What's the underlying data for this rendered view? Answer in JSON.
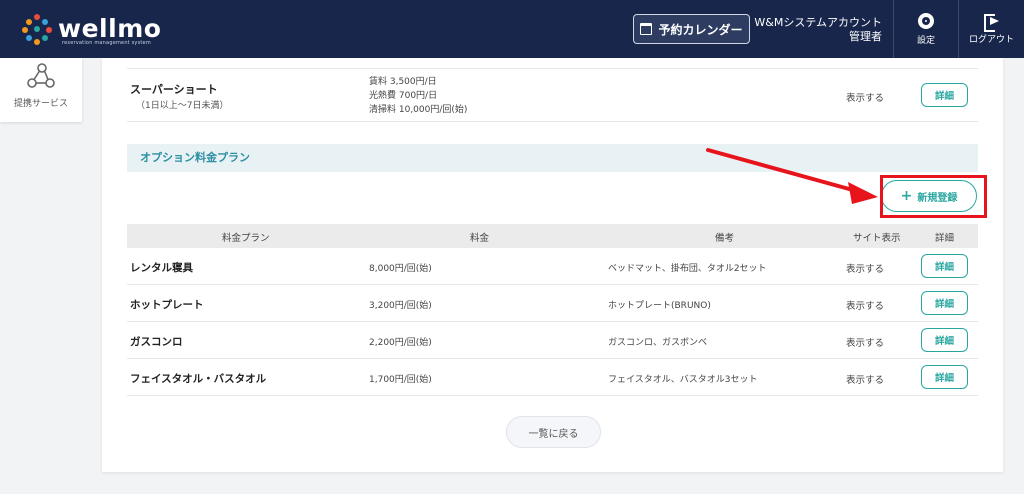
{
  "header": {
    "logo_text": "wellmo",
    "logo_tagline": "reservation management system",
    "calendar_button": "予約カレンダー",
    "account_name": "W&Mシステムアカウント",
    "account_role": "管理者",
    "settings_label": "設定",
    "logout_label": "ログアウト",
    "colors": {
      "bg": "#17264a",
      "dots": [
        "#e94e3c",
        "#f39a1e",
        "#2aa6a1",
        "#3aa0d8"
      ]
    }
  },
  "sidebar": {
    "items": [
      {
        "label": "提携サービス",
        "icon": "network-icon"
      }
    ]
  },
  "previous_row": {
    "name": "スーパーショート",
    "sub": "（1日以上～7日未満）",
    "prices": [
      "賃料 3,500円/日",
      "光熱費 700円/日",
      "清掃料 10,000円/回(始)"
    ],
    "show": "表示する",
    "detail": "詳細"
  },
  "option_section": {
    "title": "オプション料金プラン",
    "new_button": "新規登録",
    "columns": [
      "料金プラン",
      "料金",
      "備考",
      "サイト表示",
      "詳細"
    ],
    "rows": [
      {
        "name": "レンタル寝具",
        "price": "8,000円/回(始)",
        "note": "ベッドマット、掛布団、タオル2セット",
        "show": "表示する",
        "detail": "詳細"
      },
      {
        "name": "ホットプレート",
        "price": "3,200円/回(始)",
        "note": "ホットプレート(BRUNO)",
        "show": "表示する",
        "detail": "詳細"
      },
      {
        "name": "ガスコンロ",
        "price": "2,200円/回(始)",
        "note": "ガスコンロ、ガスボンベ",
        "show": "表示する",
        "detail": "詳細"
      },
      {
        "name": "フェイスタオル・バスタオル",
        "price": "1,700円/回(始)",
        "note": "フェイスタオル、バスタオル3セット",
        "show": "表示する",
        "detail": "詳細"
      }
    ]
  },
  "footer": {
    "back_button": "一覧に戻る"
  },
  "annotation": {
    "color": "#e8141c"
  }
}
